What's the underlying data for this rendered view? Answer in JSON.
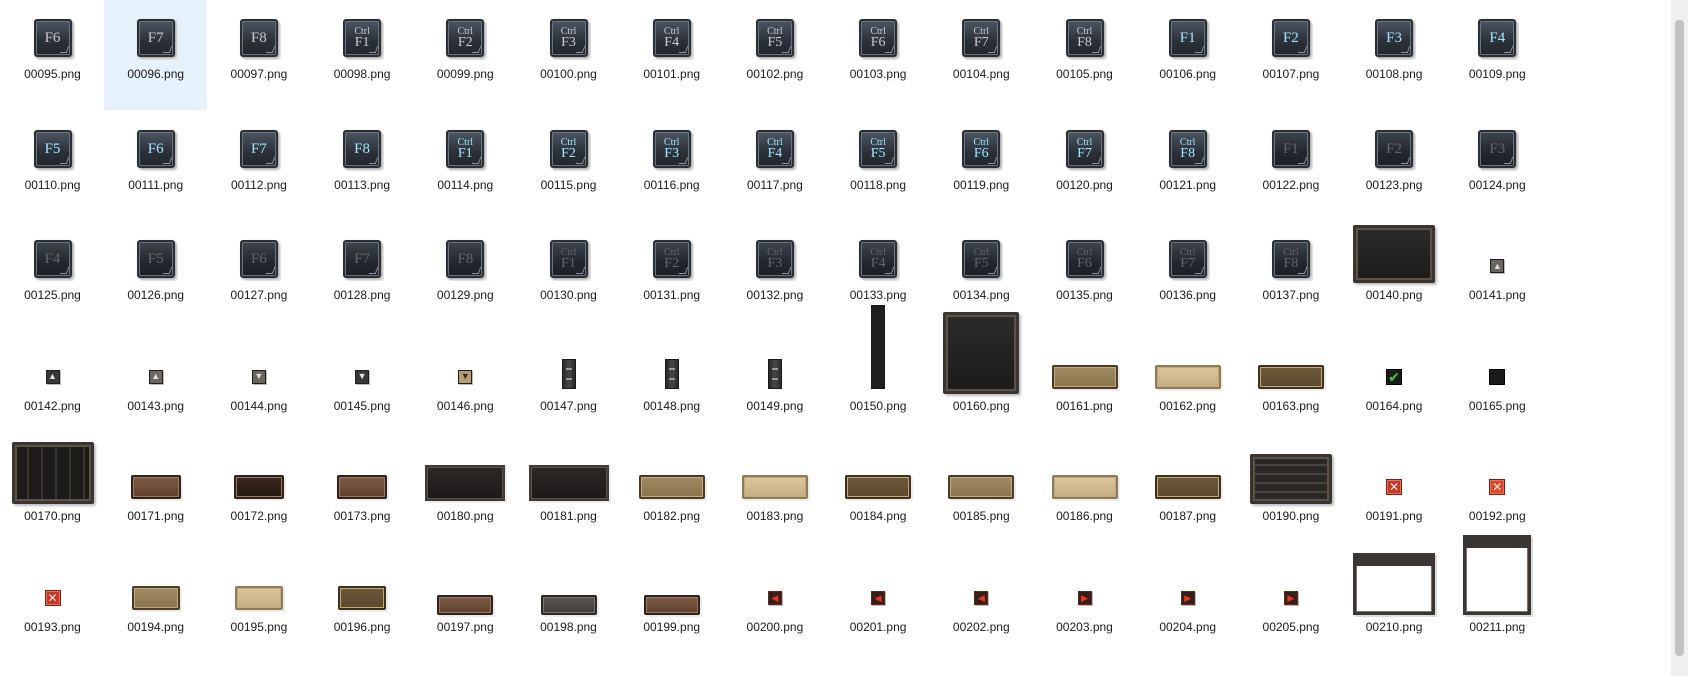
{
  "files": [
    {
      "name": "00095.png",
      "kind": "key",
      "main": "F6",
      "style": "normal"
    },
    {
      "name": "00096.png",
      "kind": "key",
      "main": "F7",
      "style": "normal",
      "selected": true
    },
    {
      "name": "00097.png",
      "kind": "key",
      "main": "F8",
      "style": "normal"
    },
    {
      "name": "00098.png",
      "kind": "key",
      "ctrl": "Ctrl",
      "sub": "F1",
      "style": "normal"
    },
    {
      "name": "00099.png",
      "kind": "key",
      "ctrl": "Ctrl",
      "sub": "F2",
      "style": "normal"
    },
    {
      "name": "00100.png",
      "kind": "key",
      "ctrl": "Ctrl",
      "sub": "F3",
      "style": "normal"
    },
    {
      "name": "00101.png",
      "kind": "key",
      "ctrl": "Ctrl",
      "sub": "F4",
      "style": "normal"
    },
    {
      "name": "00102.png",
      "kind": "key",
      "ctrl": "Ctrl",
      "sub": "F5",
      "style": "normal"
    },
    {
      "name": "00103.png",
      "kind": "key",
      "ctrl": "Ctrl",
      "sub": "F6",
      "style": "normal"
    },
    {
      "name": "00104.png",
      "kind": "key",
      "ctrl": "Ctrl",
      "sub": "F7",
      "style": "normal"
    },
    {
      "name": "00105.png",
      "kind": "key",
      "ctrl": "Ctrl",
      "sub": "F8",
      "style": "normal"
    },
    {
      "name": "00106.png",
      "kind": "key",
      "main": "F1",
      "style": "blue"
    },
    {
      "name": "00107.png",
      "kind": "key",
      "main": "F2",
      "style": "blue"
    },
    {
      "name": "00108.png",
      "kind": "key",
      "main": "F3",
      "style": "blue"
    },
    {
      "name": "00109.png",
      "kind": "key",
      "main": "F4",
      "style": "blue"
    },
    {
      "name": "00110.png",
      "kind": "key",
      "main": "F5",
      "style": "blue"
    },
    {
      "name": "00111.png",
      "kind": "key",
      "main": "F6",
      "style": "blue"
    },
    {
      "name": "00112.png",
      "kind": "key",
      "main": "F7",
      "style": "blue"
    },
    {
      "name": "00113.png",
      "kind": "key",
      "main": "F8",
      "style": "blue"
    },
    {
      "name": "00114.png",
      "kind": "key",
      "ctrl": "Ctrl",
      "sub": "F1",
      "style": "blue"
    },
    {
      "name": "00115.png",
      "kind": "key",
      "ctrl": "Ctrl",
      "sub": "F2",
      "style": "blue"
    },
    {
      "name": "00116.png",
      "kind": "key",
      "ctrl": "Ctrl",
      "sub": "F3",
      "style": "blue"
    },
    {
      "name": "00117.png",
      "kind": "key",
      "ctrl": "Ctrl",
      "sub": "F4",
      "style": "blue"
    },
    {
      "name": "00118.png",
      "kind": "key",
      "ctrl": "Ctrl",
      "sub": "F5",
      "style": "blue"
    },
    {
      "name": "00119.png",
      "kind": "key",
      "ctrl": "Ctrl",
      "sub": "F6",
      "style": "blue"
    },
    {
      "name": "00120.png",
      "kind": "key",
      "ctrl": "Ctrl",
      "sub": "F7",
      "style": "blue"
    },
    {
      "name": "00121.png",
      "kind": "key",
      "ctrl": "Ctrl",
      "sub": "F8",
      "style": "blue"
    },
    {
      "name": "00122.png",
      "kind": "key",
      "main": "F1",
      "style": "dim"
    },
    {
      "name": "00123.png",
      "kind": "key",
      "main": "F2",
      "style": "dim"
    },
    {
      "name": "00124.png",
      "kind": "key",
      "main": "F3",
      "style": "dim"
    },
    {
      "name": "00125.png",
      "kind": "key",
      "main": "F4",
      "style": "dim"
    },
    {
      "name": "00126.png",
      "kind": "key",
      "main": "F5",
      "style": "dim"
    },
    {
      "name": "00127.png",
      "kind": "key",
      "main": "F6",
      "style": "dim"
    },
    {
      "name": "00128.png",
      "kind": "key",
      "main": "F7",
      "style": "dim"
    },
    {
      "name": "00129.png",
      "kind": "key",
      "main": "F8",
      "style": "dim"
    },
    {
      "name": "00130.png",
      "kind": "key",
      "ctrl": "Ctrl",
      "sub": "F1",
      "style": "dim"
    },
    {
      "name": "00131.png",
      "kind": "key",
      "ctrl": "Ctrl",
      "sub": "F2",
      "style": "dim"
    },
    {
      "name": "00132.png",
      "kind": "key",
      "ctrl": "Ctrl",
      "sub": "F3",
      "style": "dim"
    },
    {
      "name": "00133.png",
      "kind": "key",
      "ctrl": "Ctrl",
      "sub": "F4",
      "style": "dim"
    },
    {
      "name": "00134.png",
      "kind": "key",
      "ctrl": "Ctrl",
      "sub": "F5",
      "style": "dim"
    },
    {
      "name": "00135.png",
      "kind": "key",
      "ctrl": "Ctrl",
      "sub": "F6",
      "style": "dim"
    },
    {
      "name": "00136.png",
      "kind": "key",
      "ctrl": "Ctrl",
      "sub": "F7",
      "style": "dim"
    },
    {
      "name": "00137.png",
      "kind": "key",
      "ctrl": "Ctrl",
      "sub": "F8",
      "style": "dim"
    },
    {
      "name": "00140.png",
      "kind": "panel-wide"
    },
    {
      "name": "00141.png",
      "kind": "small-button",
      "glyph": "▲",
      "style": "light"
    },
    {
      "name": "00142.png",
      "kind": "small-button",
      "glyph": "▲",
      "style": "normal"
    },
    {
      "name": "00143.png",
      "kind": "small-button",
      "glyph": "▲",
      "style": "light"
    },
    {
      "name": "00144.png",
      "kind": "small-button",
      "glyph": "▼",
      "style": "light"
    },
    {
      "name": "00145.png",
      "kind": "small-button",
      "glyph": "▼",
      "style": "normal"
    },
    {
      "name": "00146.png",
      "kind": "small-button",
      "glyph": "▼",
      "style": "gold"
    },
    {
      "name": "00147.png",
      "kind": "scroll-thumb"
    },
    {
      "name": "00148.png",
      "kind": "scroll-thumb"
    },
    {
      "name": "00149.png",
      "kind": "scroll-thumb"
    },
    {
      "name": "00150.png",
      "kind": "scroll-track"
    },
    {
      "name": "00160.png",
      "kind": "panel-tall"
    },
    {
      "name": "00161.png",
      "kind": "bar",
      "style": "gold"
    },
    {
      "name": "00162.png",
      "kind": "bar",
      "style": "light"
    },
    {
      "name": "00163.png",
      "kind": "bar",
      "style": "brown"
    },
    {
      "name": "00164.png",
      "kind": "checkbox",
      "glyph": "✔"
    },
    {
      "name": "00165.png",
      "kind": "checkbox",
      "glyph": ""
    },
    {
      "name": "00170.png",
      "kind": "panel-slots"
    },
    {
      "name": "00171.png",
      "kind": "bar-small",
      "style": "leather"
    },
    {
      "name": "00172.png",
      "kind": "bar-small",
      "style": "leather-dark"
    },
    {
      "name": "00173.png",
      "kind": "bar-small",
      "style": "leather"
    },
    {
      "name": "00180.png",
      "kind": "slab"
    },
    {
      "name": "00181.png",
      "kind": "slab"
    },
    {
      "name": "00182.png",
      "kind": "bar",
      "style": "gold"
    },
    {
      "name": "00183.png",
      "kind": "bar",
      "style": "light"
    },
    {
      "name": "00184.png",
      "kind": "bar",
      "style": "brown"
    },
    {
      "name": "00185.png",
      "kind": "bar",
      "style": "gold"
    },
    {
      "name": "00186.png",
      "kind": "bar",
      "style": "light"
    },
    {
      "name": "00187.png",
      "kind": "bar",
      "style": "brown"
    },
    {
      "name": "00190.png",
      "kind": "panel-list"
    },
    {
      "name": "00191.png",
      "kind": "close",
      "glyph": "✕",
      "style": "red"
    },
    {
      "name": "00192.png",
      "kind": "close",
      "glyph": "✕",
      "style": "orange"
    },
    {
      "name": "00193.png",
      "kind": "close",
      "glyph": "✕",
      "style": "red"
    },
    {
      "name": "00194.png",
      "kind": "bar-med",
      "style": "gold"
    },
    {
      "name": "00195.png",
      "kind": "bar-med",
      "style": "light"
    },
    {
      "name": "00196.png",
      "kind": "bar-med",
      "style": "brown"
    },
    {
      "name": "00197.png",
      "kind": "bar-tab",
      "style": "leather"
    },
    {
      "name": "00198.png",
      "kind": "bar-tab",
      "style": "gray"
    },
    {
      "name": "00199.png",
      "kind": "bar-tab",
      "style": "leather"
    },
    {
      "name": "00200.png",
      "kind": "small-button",
      "glyph": "◀",
      "style": "red"
    },
    {
      "name": "00201.png",
      "kind": "small-button",
      "glyph": "◀",
      "style": "red"
    },
    {
      "name": "00202.png",
      "kind": "small-button",
      "glyph": "◀",
      "style": "red"
    },
    {
      "name": "00203.png",
      "kind": "small-button",
      "glyph": "▶",
      "style": "red"
    },
    {
      "name": "00204.png",
      "kind": "small-button",
      "glyph": "▶",
      "style": "red"
    },
    {
      "name": "00205.png",
      "kind": "small-button",
      "glyph": "▶",
      "style": "red"
    },
    {
      "name": "00210.png",
      "kind": "white-window"
    },
    {
      "name": "00211.png",
      "kind": "white-window-tall"
    }
  ]
}
